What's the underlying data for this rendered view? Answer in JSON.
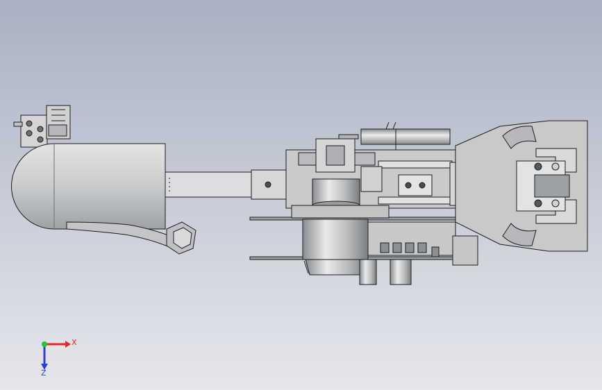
{
  "viewport": {
    "background_top": "#a9b1c2",
    "background_bottom": "#e6e7ec",
    "model_color": "#c9cbcd",
    "edge_color": "#1c1c1c"
  },
  "triad": {
    "x_label": "X",
    "z_label": "Z",
    "x_color": "#e8242a",
    "y_color": "#24c63a",
    "z_color": "#2a3fd6"
  }
}
